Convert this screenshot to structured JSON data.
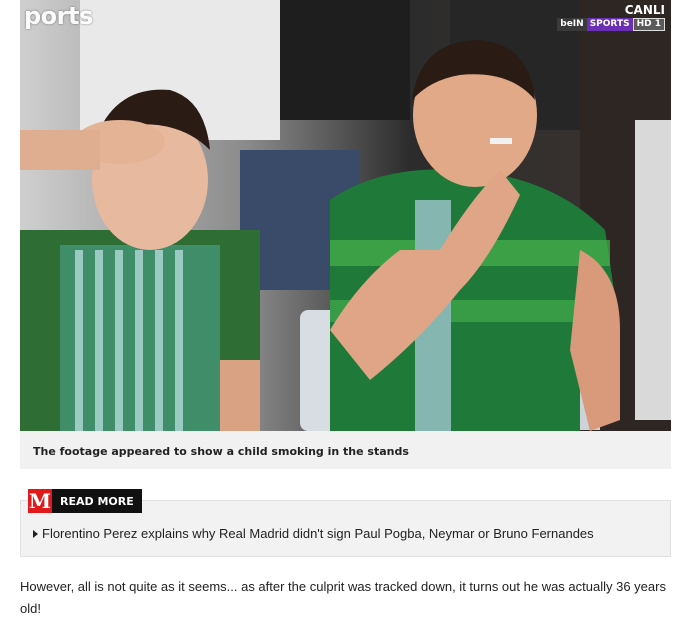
{
  "media": {
    "watermark": "ports",
    "live_label": "CANLI",
    "channel_parts": [
      "beIN",
      "SPORTS",
      "HD 1"
    ]
  },
  "caption": "The footage appeared to show a child smoking in the stands",
  "read_more": {
    "badge_letter": "M",
    "label": "READ MORE",
    "links": [
      "Florentino Perez explains why Real Madrid didn't sign Paul Pogba, Neymar or Bruno Fernandes"
    ]
  },
  "article": {
    "paragraph": "However, all is not quite as it seems... as after the culprit was tracked down, it turns out he was actually 36 years old!"
  },
  "colors": {
    "caption_bg": "#f1f1f1",
    "read_more_bg": "#f2f2f2",
    "brand_red": "#e01a1a",
    "jersey_green": "#1f7a3a",
    "sports_purple": "#6b2fb5"
  }
}
